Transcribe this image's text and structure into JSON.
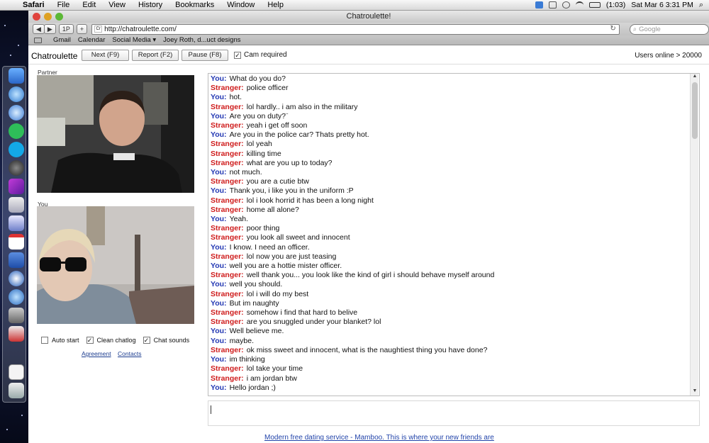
{
  "menubar": {
    "app": "Safari",
    "items": [
      "File",
      "Edit",
      "View",
      "History",
      "Bookmarks",
      "Window",
      "Help"
    ],
    "battery": "(1:03)",
    "datetime": "Sat Mar 6  3:31 PM"
  },
  "window": {
    "title": "Chatroulette!"
  },
  "toolbar": {
    "back": "◀",
    "forward": "▶",
    "onepass": "1P",
    "add": "+",
    "url": "http://chatroulette.com/",
    "search_placeholder": "Google"
  },
  "bookmarks": [
    "Gmail",
    "Calendar",
    "Social Media ▾",
    "Joey Roth, d...uct designs"
  ],
  "header": {
    "logo": "Chatroulette",
    "next": "Next (F9)",
    "report": "Report (F2)",
    "pause": "Pause (F8)",
    "cam_required": "Cam required",
    "users_online": "Users online > 20000"
  },
  "video": {
    "partner_label": "Partner",
    "you_label": "You"
  },
  "options": {
    "auto_start": "Auto start",
    "clean_chatlog": "Clean chatlog",
    "chat_sounds": "Chat sounds"
  },
  "links": {
    "agreement": "Agreement",
    "contacts": "Contacts"
  },
  "chat": {
    "messages": [
      {
        "who": "You:",
        "text": "What do you do?"
      },
      {
        "who": "Stranger:",
        "text": "police officer"
      },
      {
        "who": "You:",
        "text": "hot."
      },
      {
        "who": "Stranger:",
        "text": "lol hardly.. i am also in the military"
      },
      {
        "who": "You:",
        "text": "Are you on duty?¨"
      },
      {
        "who": "Stranger:",
        "text": "yeah i get off soon"
      },
      {
        "who": "You:",
        "text": "Are you in the police car? Thats pretty hot."
      },
      {
        "who": "Stranger:",
        "text": "lol yeah"
      },
      {
        "who": "Stranger:",
        "text": "killing time"
      },
      {
        "who": "Stranger:",
        "text": "what are you up to today?"
      },
      {
        "who": "You:",
        "text": "not much."
      },
      {
        "who": "Stranger:",
        "text": "you are a cutie btw"
      },
      {
        "who": "You:",
        "text": "Thank you, i like you in the uniform :P"
      },
      {
        "who": "Stranger:",
        "text": "lol i look horrid it has been a long night"
      },
      {
        "who": "Stranger:",
        "text": "home all alone?"
      },
      {
        "who": "You:",
        "text": "Yeah."
      },
      {
        "who": "Stranger:",
        "text": "poor thing"
      },
      {
        "who": "Stranger:",
        "text": "you look all sweet and innocent"
      },
      {
        "who": "You:",
        "text": "I know. I need an officer."
      },
      {
        "who": "Stranger:",
        "text": "lol now you are just teasing"
      },
      {
        "who": "You:",
        "text": "well you are a hottie mister officer."
      },
      {
        "who": "Stranger:",
        "text": "well thank you... you look like the kind of girl i should behave myself around"
      },
      {
        "who": "You:",
        "text": "well you should."
      },
      {
        "who": "Stranger:",
        "text": "lol i will do my best"
      },
      {
        "who": "You:",
        "text": "But im naughty"
      },
      {
        "who": "Stranger:",
        "text": "somehow i find that hard to belive"
      },
      {
        "who": "Stranger:",
        "text": "are you snuggled under your blanket? lol"
      },
      {
        "who": "You:",
        "text": "Well believe me."
      },
      {
        "who": "You:",
        "text": "maybe."
      },
      {
        "who": "Stranger:",
        "text": "ok miss sweet and innocent, what is the naughtiest thing you have done?"
      },
      {
        "who": "You:",
        "text": "im thinking"
      },
      {
        "who": "Stranger:",
        "text": "lol take your time"
      },
      {
        "who": "Stranger:",
        "text": "i am jordan btw"
      },
      {
        "who": "You:",
        "text": "Hello jordan ;)"
      }
    ]
  },
  "ad": "Modern free dating service - Mamboo. This is where your new friends are",
  "colors": {
    "you": "#2237b3",
    "stranger": "#cf1c1c",
    "link": "#2244aa"
  }
}
